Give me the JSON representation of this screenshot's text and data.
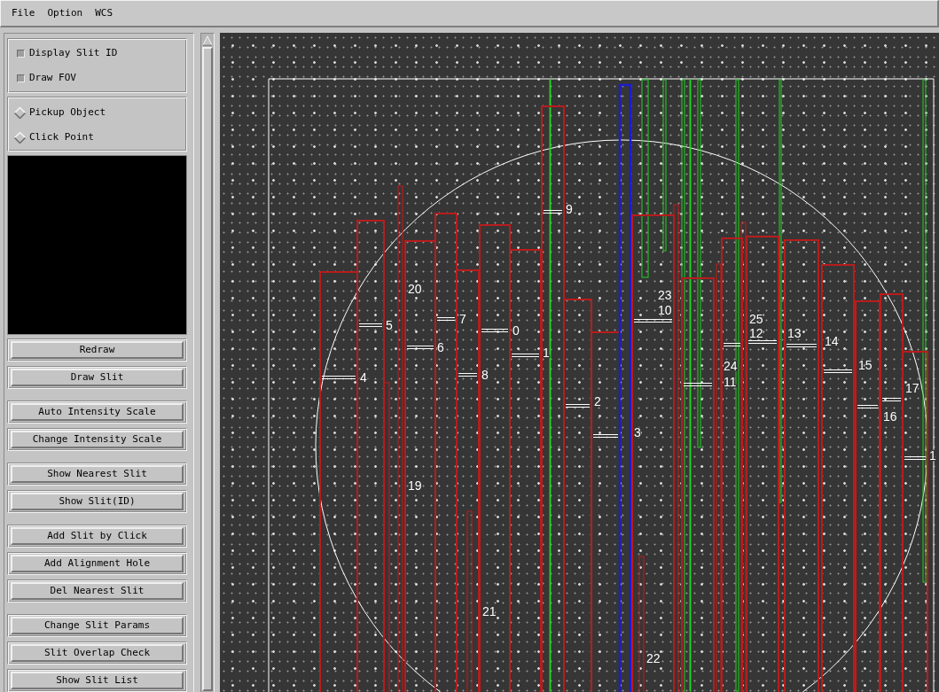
{
  "menu": [
    {
      "label": "File"
    },
    {
      "label": "Option"
    },
    {
      "label": "WCS"
    }
  ],
  "display_options": [
    {
      "label": "Display Slit ID",
      "checked": true
    },
    {
      "label": "Draw FOV",
      "checked": true
    }
  ],
  "pick_modes": [
    {
      "label": "Pickup Object",
      "selected": false
    },
    {
      "label": "Click Point",
      "selected": false
    }
  ],
  "button_groups": [
    [
      "Redraw",
      "Draw Slit"
    ],
    [
      "Auto Intensity Scale",
      "Change Intensity Scale"
    ],
    [
      "Show Nearest Slit",
      "Show Slit(ID)"
    ],
    [
      "Add Slit by Click",
      "Add Alignment Hole",
      "Del Nearest Slit"
    ],
    [
      "Change Slit Params",
      "Slit Overlap Check",
      "Show Slit List"
    ]
  ],
  "image": {
    "slits": [
      {
        "label": "4",
        "selected": false
      },
      {
        "label": "5",
        "selected": false
      },
      {
        "label": "19",
        "selected": false
      },
      {
        "label": "20",
        "selected": false
      },
      {
        "label": "6",
        "selected": false
      },
      {
        "label": "7",
        "selected": false
      },
      {
        "label": "8",
        "selected": false
      },
      {
        "label": "21",
        "selected": false
      },
      {
        "label": "0",
        "selected": false
      },
      {
        "label": "1",
        "selected": false
      },
      {
        "label": "9",
        "selected": false
      },
      {
        "label": "2",
        "selected": false
      },
      {
        "label": "3",
        "selected": false
      },
      {
        "selected": true
      },
      {
        "label": "10",
        "selected": false
      },
      {
        "label": "22",
        "selected": false
      },
      {
        "label": "23",
        "selected": false
      },
      {
        "label": "11",
        "selected": false
      },
      {
        "label": "24",
        "selected": false
      },
      {
        "label": "12",
        "selected": false
      },
      {
        "label": "25",
        "selected": false
      },
      {
        "label": "13",
        "selected": false
      },
      {
        "label": "14",
        "selected": false
      },
      {
        "label": "15",
        "selected": false
      },
      {
        "label": "16",
        "selected": false
      },
      {
        "label": "17",
        "selected": false
      },
      {
        "label": "1",
        "selected": false
      }
    ]
  }
}
